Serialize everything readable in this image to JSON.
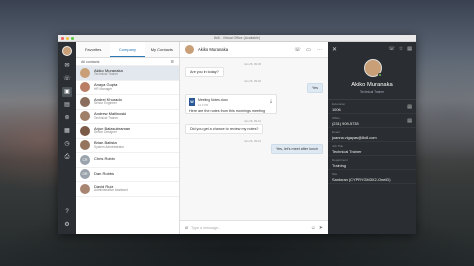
{
  "window": {
    "title": "8x8 - Virtual Office (Available)"
  },
  "rail": {
    "items": [
      "message-icon",
      "phone-icon",
      "contacts-icon",
      "chat-icon",
      "voicemail-icon",
      "calendar-icon",
      "meetings-icon",
      "fax-icon"
    ],
    "bottom": [
      "help-icon",
      "settings-icon"
    ]
  },
  "contacts": {
    "tabs": [
      "Favorites",
      "Company",
      "My Contacts"
    ],
    "active_tab": "Company",
    "filter_label": "All contacts",
    "list": [
      {
        "name": "Akiko Muranaka",
        "role": "Technical Trainer",
        "avatar_color": "#c99f77",
        "initials": ""
      },
      {
        "name": "Anaya Gupta",
        "role": "HR Manager",
        "avatar_color": "#b97d65",
        "initials": ""
      },
      {
        "name": "Andrei Khurado",
        "role": "Senior Engineer",
        "avatar_color": "#8a6d5c",
        "initials": ""
      },
      {
        "name": "Andrew Mallinoski",
        "role": "Technical Trainer",
        "avatar_color": "#a07f69",
        "initials": ""
      },
      {
        "name": "Arjun Balasubraman",
        "role": "Senior Designer",
        "avatar_color": "#7b5a48",
        "initials": ""
      },
      {
        "name": "Brian Batista",
        "role": "System Administrator",
        "avatar_color": "#96755e",
        "initials": ""
      },
      {
        "name": "Chris Robin",
        "role": "",
        "avatar_color": "#9aa3ab",
        "initials": "CR"
      },
      {
        "name": "Dan Robbs",
        "role": "",
        "avatar_color": "#9aa3ab",
        "initials": "DR"
      },
      {
        "name": "David Ruiz",
        "role": "Administrative Assistant",
        "avatar_color": "#a88570",
        "initials": ""
      }
    ]
  },
  "chat": {
    "contact_name": "Akiko Muranaka",
    "timestamps": [
      "Jan 26, 09:30",
      "Jan 26, 09:32",
      "Jan 26, 09:41",
      "Jan 26, 09:44"
    ],
    "messages": [
      "Are you in today?",
      "Yes",
      "Did you get a chance to review my notes?",
      "Yes, let's meet after lunch"
    ],
    "file": {
      "name": "Meeting Notes.docx",
      "size": "12.3 KB",
      "caption": "Here are the notes from this mornings meeting"
    },
    "input_placeholder": "Type a message..."
  },
  "profile": {
    "name": "Akiko Muranaka",
    "role": "Technical Trainer",
    "fields": [
      {
        "label": "Extension",
        "value": "1006",
        "icon": "chat-icon"
      },
      {
        "label": "Office",
        "value": "(231) 909-5735",
        "icon": "chat-icon"
      },
      {
        "label": "Email",
        "value": "joanna.vigayas@8x8.com",
        "icon": ""
      },
      {
        "label": "Job Title",
        "value": "Technical Trainer",
        "icon": ""
      },
      {
        "label": "Department",
        "value": "Training",
        "icon": ""
      },
      {
        "label": "Site",
        "value": "Santoran (CYPRYGM3X2-OneID)",
        "icon": ""
      }
    ]
  }
}
